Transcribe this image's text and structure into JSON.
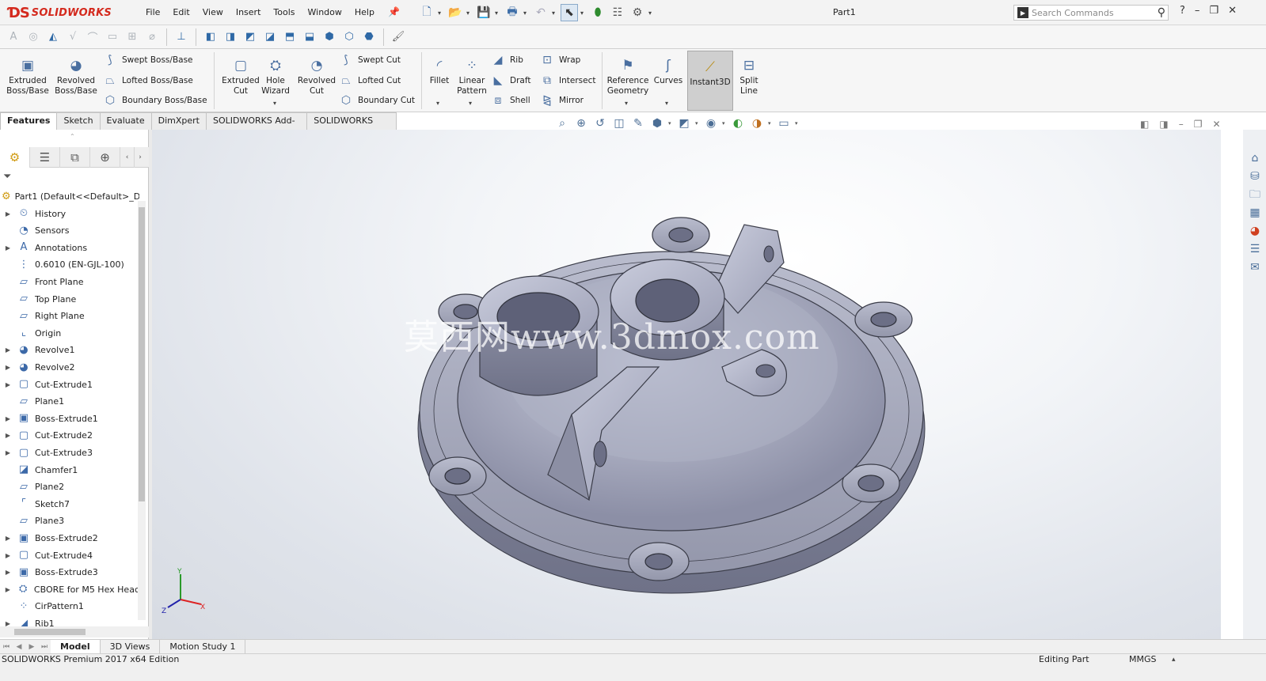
{
  "app": {
    "logo_text": "SOLIDWORKS",
    "document_title": "Part1"
  },
  "menu": [
    "File",
    "Edit",
    "View",
    "Insert",
    "Tools",
    "Window",
    "Help"
  ],
  "search": {
    "placeholder": "Search Commands"
  },
  "help_label": "?",
  "command_manager": {
    "features": {
      "extruded_boss": "Extruded\nBoss/Base",
      "revolved_boss": "Revolved\nBoss/Base",
      "swept_boss": "Swept Boss/Base",
      "lofted_boss": "Lofted Boss/Base",
      "boundary_boss": "Boundary Boss/Base",
      "extruded_cut": "Extruded\nCut",
      "hole_wizard": "Hole\nWizard",
      "revolved_cut": "Revolved\nCut",
      "swept_cut": "Swept Cut",
      "lofted_cut": "Lofted Cut",
      "boundary_cut": "Boundary Cut",
      "fillet": "Fillet",
      "linear_pattern": "Linear\nPattern",
      "rib": "Rib",
      "draft": "Draft",
      "shell": "Shell",
      "wrap": "Wrap",
      "intersect": "Intersect",
      "mirror": "Mirror",
      "reference_geometry": "Reference\nGeometry",
      "curves": "Curves",
      "instant3d": "Instant3D",
      "split_line": "Split\nLine"
    }
  },
  "tabs": [
    "Features",
    "Sketch",
    "Evaluate",
    "DimXpert",
    "SOLIDWORKS Add-Ins",
    "SOLIDWORKS MBD"
  ],
  "active_tab": "Features",
  "tree": {
    "root": "Part1  (Default<<Default>_D",
    "items": [
      {
        "label": "History",
        "icon": "history-icon",
        "expandable": true
      },
      {
        "label": "Sensors",
        "icon": "sensors-icon",
        "expandable": false
      },
      {
        "label": "Annotations",
        "icon": "annotations-icon",
        "expandable": true
      },
      {
        "label": "0.6010 (EN-GJL-100)",
        "icon": "material-icon",
        "expandable": false
      },
      {
        "label": "Front Plane",
        "icon": "plane-icon",
        "expandable": false
      },
      {
        "label": "Top Plane",
        "icon": "plane-icon",
        "expandable": false
      },
      {
        "label": "Right Plane",
        "icon": "plane-icon",
        "expandable": false
      },
      {
        "label": "Origin",
        "icon": "origin-icon",
        "expandable": false
      },
      {
        "label": "Revolve1",
        "icon": "revolve-icon",
        "expandable": true
      },
      {
        "label": "Revolve2",
        "icon": "revolve-icon",
        "expandable": true
      },
      {
        "label": "Cut-Extrude1",
        "icon": "cut-extrude-icon",
        "expandable": true
      },
      {
        "label": "Plane1",
        "icon": "plane-icon",
        "expandable": false
      },
      {
        "label": "Boss-Extrude1",
        "icon": "boss-extrude-icon",
        "expandable": true
      },
      {
        "label": "Cut-Extrude2",
        "icon": "cut-extrude-icon",
        "expandable": true
      },
      {
        "label": "Cut-Extrude3",
        "icon": "cut-extrude-icon",
        "expandable": true
      },
      {
        "label": "Chamfer1",
        "icon": "chamfer-icon",
        "expandable": false
      },
      {
        "label": "Plane2",
        "icon": "plane-icon",
        "expandable": false
      },
      {
        "label": "Sketch7",
        "icon": "sketch-icon",
        "expandable": false
      },
      {
        "label": "Plane3",
        "icon": "plane-icon",
        "expandable": false
      },
      {
        "label": "Boss-Extrude2",
        "icon": "boss-extrude-icon",
        "expandable": true
      },
      {
        "label": "Cut-Extrude4",
        "icon": "cut-extrude-icon",
        "expandable": true
      },
      {
        "label": "Boss-Extrude3",
        "icon": "boss-extrude-icon",
        "expandable": true
      },
      {
        "label": "CBORE for M5 Hex Heac",
        "icon": "hole-icon",
        "expandable": true
      },
      {
        "label": "CirPattern1",
        "icon": "pattern-icon",
        "expandable": false
      },
      {
        "label": "Rib1",
        "icon": "rib-icon",
        "expandable": true
      }
    ]
  },
  "watermark": "莫西网www.3dmox.com",
  "bottom_tabs": [
    "Model",
    "3D Views",
    "Motion Study 1"
  ],
  "status": {
    "edition": "SOLIDWORKS Premium 2017 x64 Edition",
    "mode": "Editing Part",
    "units": "MMGS"
  },
  "triad": {
    "x": "X",
    "y": "Y",
    "z": "Z"
  },
  "colors": {
    "accent": "#d42a1e",
    "model": "#a9acc0",
    "viewport_bg": "#eef1f5"
  }
}
